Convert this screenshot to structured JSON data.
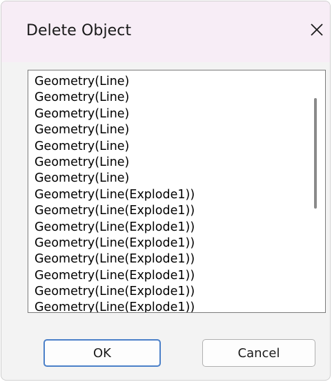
{
  "dialog": {
    "title": "Delete Object",
    "close_icon": "close-icon"
  },
  "list": {
    "items": [
      "Geometry(Line)",
      "Geometry(Line)",
      "Geometry(Line)",
      "Geometry(Line)",
      "Geometry(Line)",
      "Geometry(Line)",
      "Geometry(Line)",
      "Geometry(Line(Explode1))",
      "Geometry(Line(Explode1))",
      "Geometry(Line(Explode1))",
      "Geometry(Line(Explode1))",
      "Geometry(Line(Explode1))",
      "Geometry(Line(Explode1))",
      "Geometry(Line(Explode1))",
      "Geometry(Line(Explode1))"
    ]
  },
  "buttons": {
    "ok_label": "OK",
    "cancel_label": "Cancel"
  },
  "colors": {
    "title_bar": "#f7edf6",
    "dialog_body": "#f3f3f3",
    "ok_border": "#4a7fc8"
  }
}
